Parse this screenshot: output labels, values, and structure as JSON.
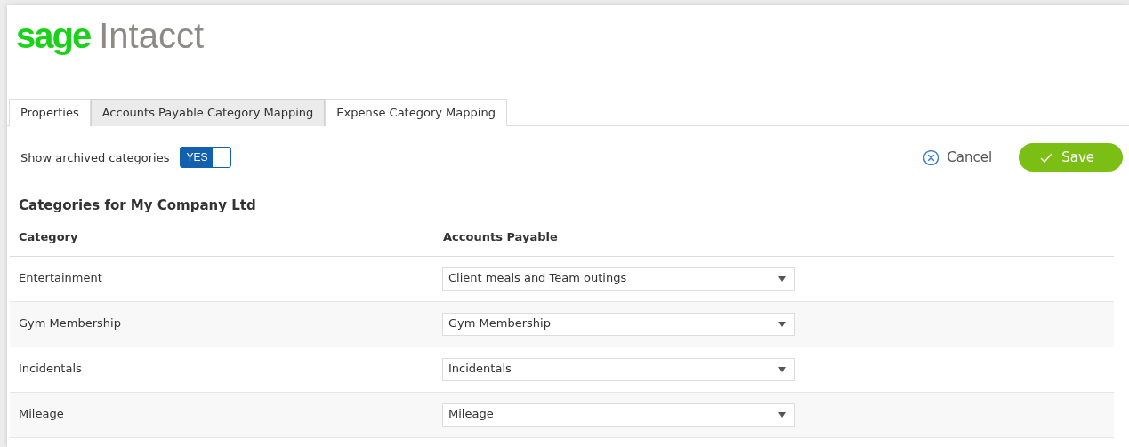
{
  "logo": {
    "brand": "sage",
    "product": "Intacct"
  },
  "tabs": [
    {
      "label": "Properties",
      "selected": false
    },
    {
      "label": "Accounts Payable Category Mapping",
      "selected": true
    },
    {
      "label": "Expense Category Mapping",
      "selected": false
    }
  ],
  "archived_toggle": {
    "label": "Show archived categories",
    "on": true,
    "state_text": "YES"
  },
  "actions": {
    "cancel": "Cancel",
    "save": "Save"
  },
  "section_title": "Categories for My Company Ltd",
  "table": {
    "columns": [
      "Category",
      "Accounts Payable"
    ],
    "rows": [
      {
        "category": "Entertainment",
        "mapping": "Client meals and Team outings"
      },
      {
        "category": "Gym Membership",
        "mapping": "Gym Membership"
      },
      {
        "category": "Incidentals",
        "mapping": "Incidentals"
      },
      {
        "category": "Mileage",
        "mapping": "Mileage"
      }
    ]
  }
}
